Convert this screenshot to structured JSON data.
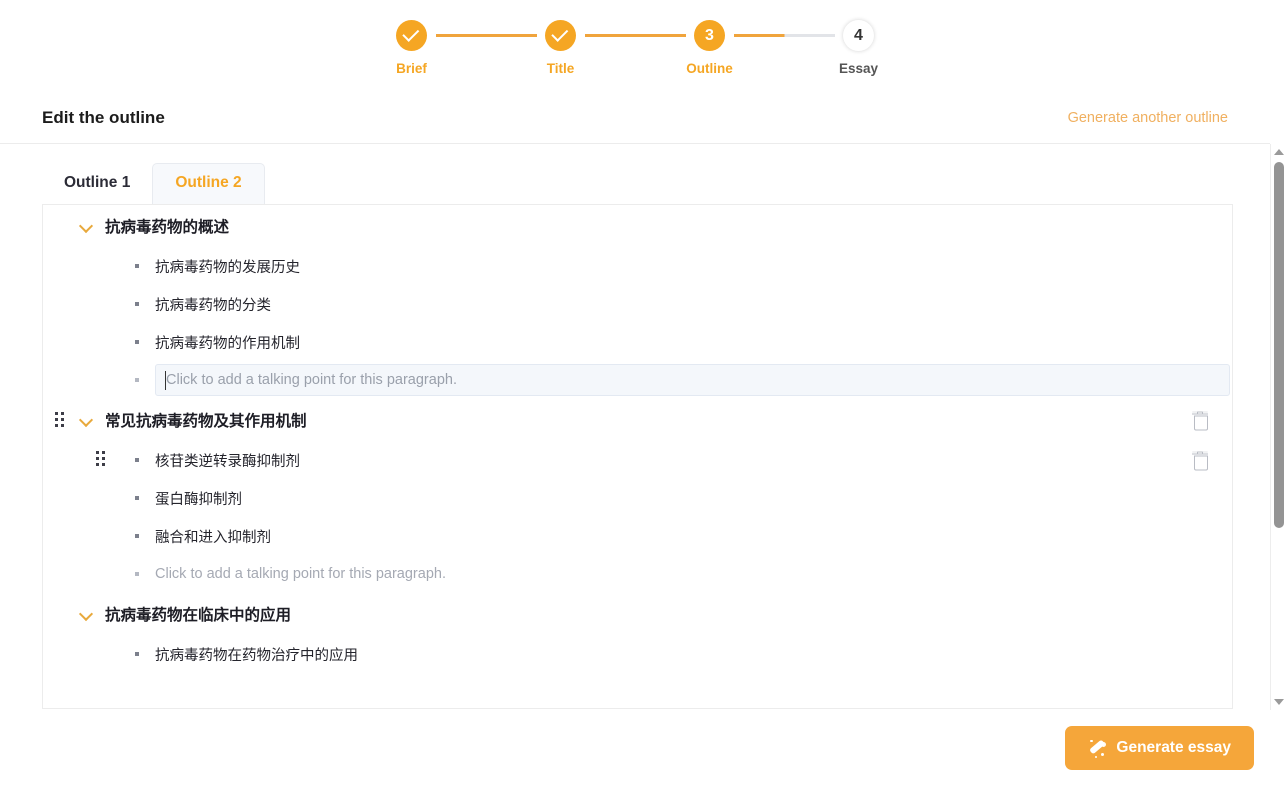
{
  "stepper": {
    "steps": [
      {
        "label": "Brief",
        "state": "done",
        "display": "check"
      },
      {
        "label": "Title",
        "state": "done",
        "display": "check"
      },
      {
        "label": "Outline",
        "state": "current",
        "display": "3"
      },
      {
        "label": "Essay",
        "state": "upcoming",
        "display": "4"
      }
    ],
    "accent_color": "#f5a623",
    "inactive_color": "#e2e4e8"
  },
  "header": {
    "title": "Edit the outline",
    "generate_another_label": "Generate another outline"
  },
  "tabs": [
    {
      "label": "Outline 1",
      "active": false
    },
    {
      "label": "Outline 2",
      "active": true
    }
  ],
  "outline": {
    "placeholder_text": "Click to add a talking point for this paragraph.",
    "sections": [
      {
        "title": "抗病毒药物的概述",
        "has_drag_handle": false,
        "has_delete": false,
        "points": [
          {
            "text": "抗病毒药物的发展历史",
            "type": "text",
            "has_drag_handle": false,
            "has_delete": false
          },
          {
            "text": "抗病毒药物的分类",
            "type": "text",
            "has_drag_handle": false,
            "has_delete": false
          },
          {
            "text": "抗病毒药物的作用机制",
            "type": "text",
            "has_drag_handle": false,
            "has_delete": false
          },
          {
            "text": "Click to add a talking point for this paragraph.",
            "type": "input-focused",
            "has_drag_handle": false,
            "has_delete": false
          }
        ]
      },
      {
        "title": "常见抗病毒药物及其作用机制",
        "has_drag_handle": true,
        "has_delete": true,
        "points": [
          {
            "text": "核苷类逆转录酶抑制剂",
            "type": "text",
            "has_drag_handle": true,
            "has_delete": true
          },
          {
            "text": "蛋白酶抑制剂",
            "type": "text",
            "has_drag_handle": false,
            "has_delete": false
          },
          {
            "text": "融合和进入抑制剂",
            "type": "text",
            "has_drag_handle": false,
            "has_delete": false
          },
          {
            "text": "Click to add a talking point for this paragraph.",
            "type": "placeholder",
            "has_drag_handle": false,
            "has_delete": false
          }
        ]
      },
      {
        "title": "抗病毒药物在临床中的应用",
        "has_drag_handle": false,
        "has_delete": false,
        "points": [
          {
            "text": "抗病毒药物在药物治疗中的应用",
            "type": "text",
            "has_drag_handle": false,
            "has_delete": false
          }
        ]
      }
    ]
  },
  "scrollbar": {
    "up_arrow_icon": "caret-up-icon",
    "down_arrow_icon": "caret-down-icon"
  },
  "footer": {
    "generate_essay_label": "Generate essay",
    "generate_essay_icon": "magic-wand-icon",
    "button_color": "#f5a63a"
  }
}
